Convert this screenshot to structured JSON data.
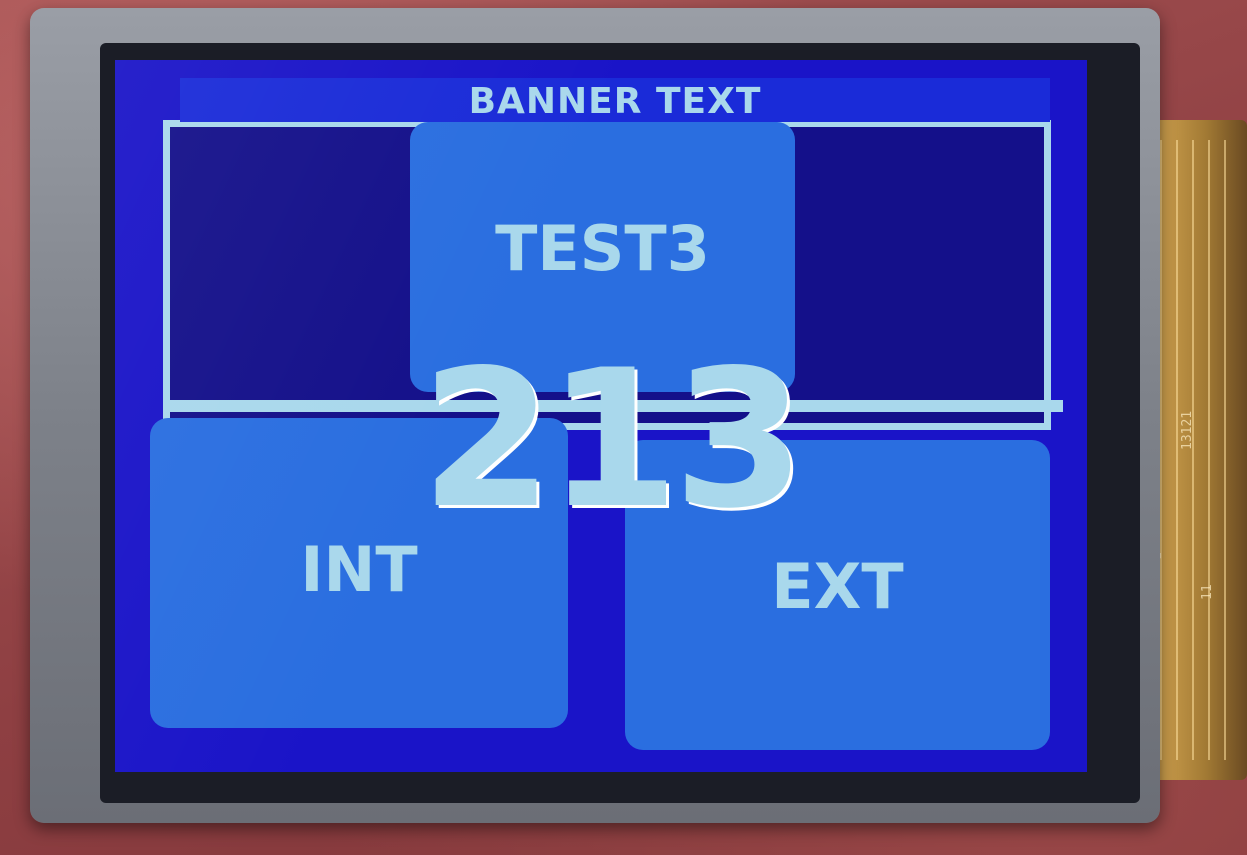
{
  "screen": {
    "banner": "BANNER TEXT",
    "buttons": {
      "test3": "TEST3",
      "int": "INT",
      "ext": "EXT"
    },
    "counter": "213"
  },
  "cable": {
    "labels": [
      "121",
      "13121",
      "1",
      "11"
    ]
  },
  "colors": {
    "screen_bg": "#1a14c8",
    "button": "#2a6ee0",
    "text": "#a9d8ec"
  }
}
